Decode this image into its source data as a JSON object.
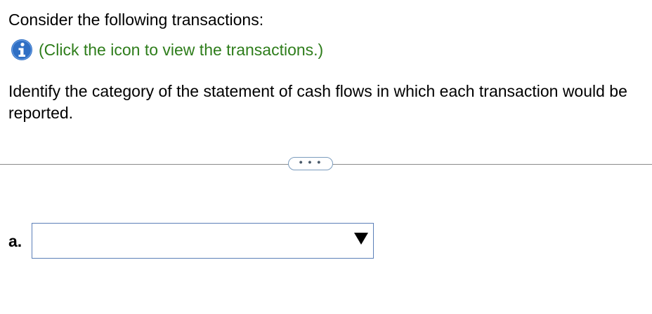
{
  "question": {
    "intro": "Consider the following transactions:",
    "info_link": "(Click the icon to view the transactions.)",
    "info_icon": "info-icon",
    "instruction": "Identify the category of the statement of cash flows in which each transaction would be reported."
  },
  "expander": {
    "label": "• • •"
  },
  "answers": [
    {
      "label": "a.",
      "selected": ""
    }
  ],
  "colors": {
    "link_green": "#2e7d1b",
    "info_blue": "#2f6fc4",
    "select_border": "#5b7fb8",
    "divider": "#8a8a8a"
  }
}
